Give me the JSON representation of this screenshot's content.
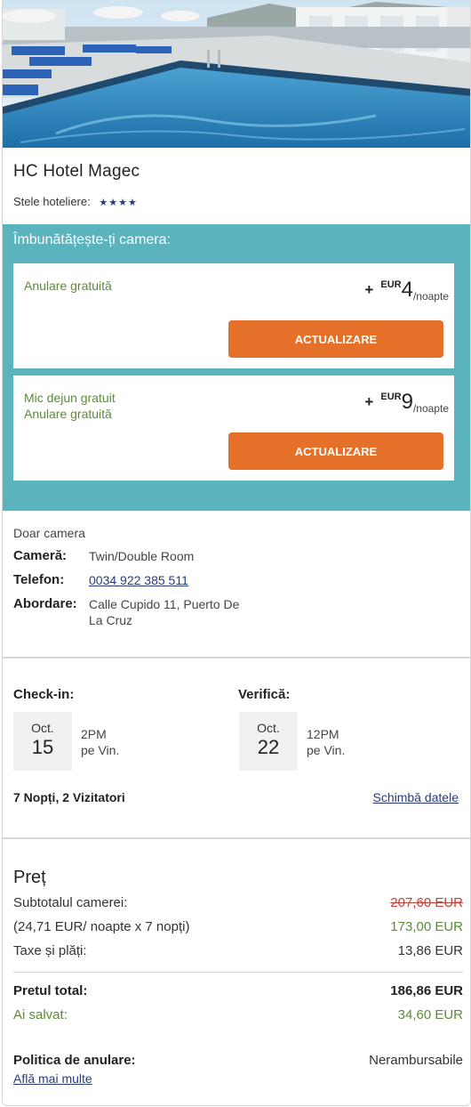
{
  "hotel": {
    "name": "HC Hotel Magec",
    "stars_label": "Stele hoteliere:",
    "stars": "★★★★"
  },
  "upgrade": {
    "title": "Îmbunătățește-ți camera:",
    "options": [
      {
        "features": [
          "Anulare gratuită"
        ],
        "plus": "+",
        "currency": "EUR",
        "amount": "4",
        "per": "/noapte",
        "button": "ACTUALIZARE"
      },
      {
        "features": [
          "Mic dejun gratuit",
          "Anulare gratuită"
        ],
        "plus": "+",
        "currency": "EUR",
        "amount": "9",
        "per": "/noapte",
        "button": "ACTUALIZARE"
      }
    ]
  },
  "info": {
    "room_only": "Doar camera",
    "room_label": "Cameră:",
    "room_value": "Twin/Double Room",
    "phone_label": "Telefon:",
    "phone_value": "0034 922 385 511",
    "address_label": "Abordare:",
    "address_value": "Calle Cupido 11, Puerto De La Cruz"
  },
  "dates": {
    "checkin_title": "Check-in:",
    "checkin_month": "Oct.",
    "checkin_day": "15",
    "checkin_time": "2PM",
    "checkin_weekday": "pe Vin.",
    "checkout_title": "Verifică:",
    "checkout_month": "Oct.",
    "checkout_day": "22",
    "checkout_time": "12PM",
    "checkout_weekday": "pe Vin.",
    "summary": "7 Nopți, 2 Vizitatori",
    "change_link": "Schimbă datele"
  },
  "price": {
    "title": "Preț",
    "subtotal_label": "Subtotalul camerei:",
    "subtotal_old": "207,60 EUR",
    "per_night_label": "(24,71 EUR/ noapte x 7 nopți)",
    "per_night_total": "173,00 EUR",
    "taxes_label": "Taxe și plăți:",
    "taxes_value": "13,86 EUR",
    "total_label": "Pretul total:",
    "total_value": "186,86 EUR",
    "saved_label": "Ai salvat:",
    "saved_value": "34,60 EUR",
    "cancel_label": "Politica de anulare:",
    "cancel_value": "Nerambursabile",
    "learn_more": "Află mai multe"
  },
  "colors": {
    "teal_panel": "#5ab3bd",
    "button_orange": "#e5702a",
    "feature_green": "#5e8a3a",
    "link_blue": "#2b3a7a",
    "strike_red": "#c8413a"
  }
}
